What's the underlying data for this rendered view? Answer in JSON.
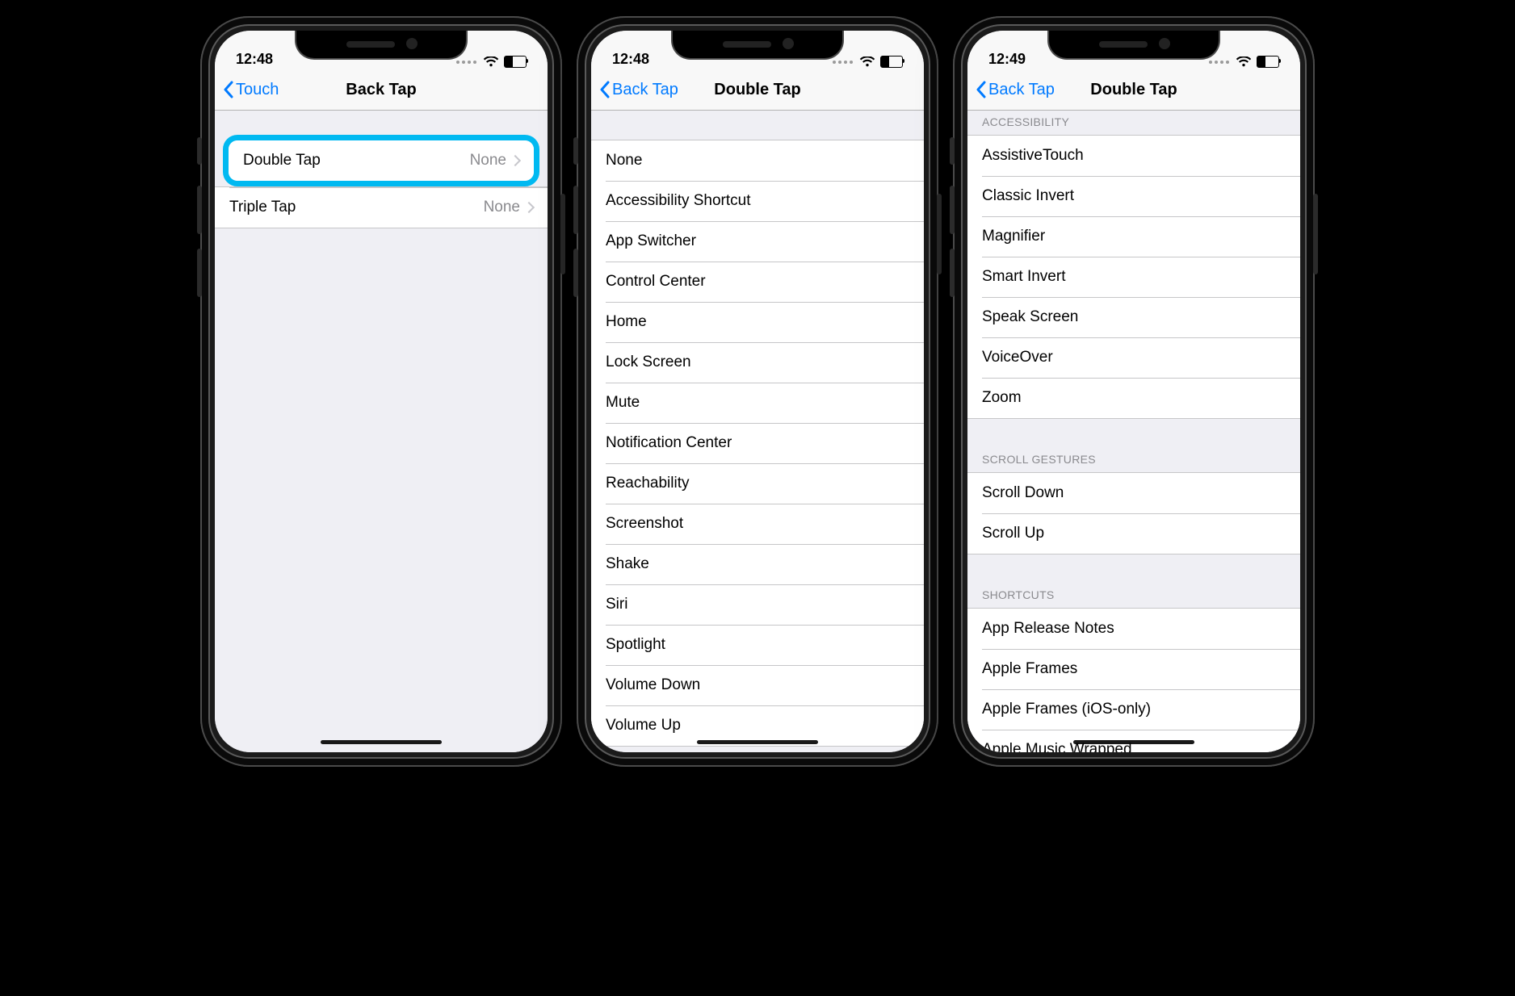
{
  "highlight_color": "#00B9F1",
  "phones": [
    {
      "status": {
        "time": "12:48"
      },
      "nav": {
        "back": "Touch",
        "title": "Back Tap"
      },
      "layout": "summary",
      "summary": [
        {
          "label": "Double Tap",
          "value": "None",
          "highlighted": true
        },
        {
          "label": "Triple Tap",
          "value": "None",
          "highlighted": false
        }
      ]
    },
    {
      "status": {
        "time": "12:48"
      },
      "nav": {
        "back": "Back Tap",
        "title": "Double Tap"
      },
      "layout": "list",
      "sections": [
        {
          "header": null,
          "items": [
            "None",
            "Accessibility Shortcut",
            "App Switcher",
            "Control Center",
            "Home",
            "Lock Screen",
            "Mute",
            "Notification Center",
            "Reachability",
            "Screenshot",
            "Shake",
            "Siri",
            "Spotlight",
            "Volume Down",
            "Volume Up"
          ]
        }
      ]
    },
    {
      "status": {
        "time": "12:49"
      },
      "nav": {
        "back": "Back Tap",
        "title": "Double Tap"
      },
      "layout": "list",
      "sections": [
        {
          "header": "Accessibility",
          "items": [
            "AssistiveTouch",
            "Classic Invert",
            "Magnifier",
            "Smart Invert",
            "Speak Screen",
            "VoiceOver",
            "Zoom"
          ]
        },
        {
          "header": "Scroll Gestures",
          "items": [
            "Scroll Down",
            "Scroll Up"
          ]
        },
        {
          "header": "Shortcuts",
          "items": [
            "App Release Notes",
            "Apple Frames",
            "Apple Frames (iOS-only)",
            "Apple Music Wrapped"
          ]
        }
      ]
    }
  ]
}
